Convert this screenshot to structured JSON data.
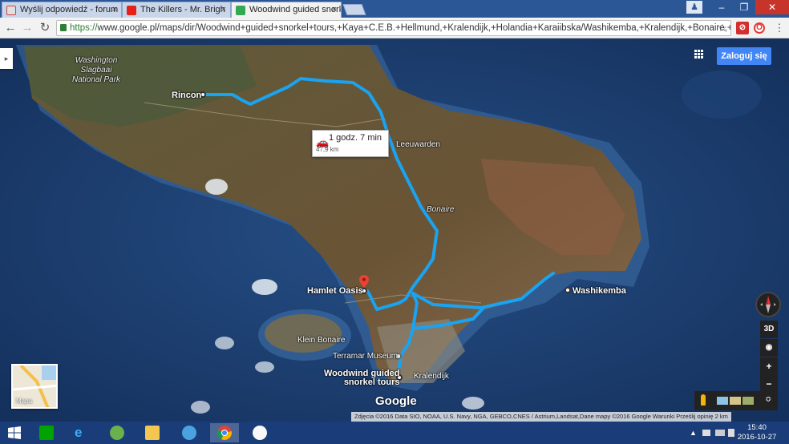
{
  "browser": {
    "tabs": [
      {
        "title": "Wyślij odpowiedź - forum",
        "active": false
      },
      {
        "title": "The Killers - Mr. Brigh",
        "active": false
      },
      {
        "title": "Woodwind guided snork",
        "active": true
      }
    ],
    "url_scheme": "https://",
    "url_rest": "www.google.pl/maps/dir/Woodwind+guided+snorkel+tours,+Kaya+C.E.B.+Hellmund,+Kralendijk,+Holandia+Karaiibska/Washikemba,+Kralendijk,+Bonaire,+Holandia+Karaib"
  },
  "map": {
    "route": {
      "duration": "1 godz. 7 min",
      "distance": "47,9 km"
    },
    "labels": {
      "park": "Washington\nSlagbaai\nNational Park",
      "rincon": "Rincon",
      "leeuwarden": "Leeuwarden",
      "bonaire": "Bonaire",
      "hamlet": "Hamlet Oasis",
      "washikemba": "Washikemba",
      "klein": "Klein Bonaire",
      "terramar": "Terramar Museum",
      "woodwind_1": "Woodwind guided",
      "woodwind_2": "snorkel tours",
      "kralendijk": "Kralendijk"
    },
    "login": "Zaloguj się",
    "minimap_label": "Mapa",
    "controls": {
      "three_d": "3D",
      "zoom_in": "+",
      "zoom_out": "−"
    },
    "google": "Google",
    "attribution": "Zdjęcia ©2016 Data SIO, NOAA, U.S. Navy, NGA, GEBCO,CNES / Astrium,Landsat,Dane mapy ©2016 Google    Warunki    Prześlij opinię    2 km",
    "colors": {
      "route": "#1aa3f0",
      "sea": "#1e4070",
      "land": "#5e5538"
    }
  },
  "taskbar": {
    "time": "15:40",
    "date": "2016-10-27"
  }
}
